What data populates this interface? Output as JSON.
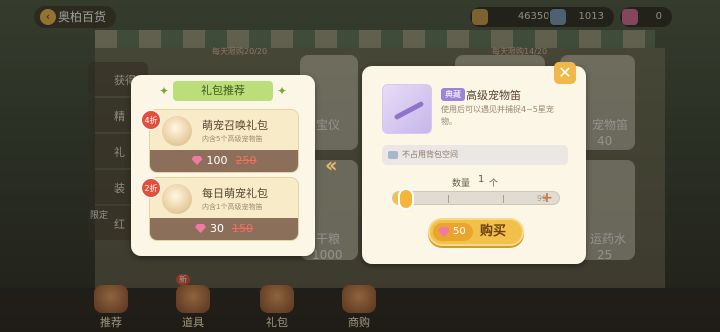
{
  "header": {
    "title": "奥柏百货",
    "resources": [
      {
        "icon": "coin-icon",
        "value": "463502"
      },
      {
        "icon": "crystal-icon",
        "value": "1013"
      },
      {
        "icon": "gem-icon",
        "value": "0"
      }
    ]
  },
  "background": {
    "side_tabs": [
      "获得",
      "精",
      "礼",
      "装",
      "红"
    ],
    "tags": [
      "每天限购20/20",
      "每天限购14/20",
      "限定"
    ],
    "card_labels": [
      "宝仪",
      "宠物笛",
      "苗",
      "干粮",
      "运药水"
    ],
    "prices": [
      "40",
      "1000",
      "25"
    ],
    "bottom_nav": [
      {
        "label": "推荐",
        "icon": "recommend-icon"
      },
      {
        "label": "道具",
        "icon": "items-icon",
        "badge": "新"
      },
      {
        "label": "礼包",
        "icon": "gift-icon"
      },
      {
        "label": "商购",
        "icon": "shop-icon"
      }
    ]
  },
  "gift_panel": {
    "title": "礼包推荐",
    "packs": [
      {
        "discount": "4折",
        "name": "萌宠召唤礼包",
        "desc": "内含5个高级宠物笛",
        "price": "100",
        "original_price": "250"
      },
      {
        "discount": "2折",
        "name": "每日萌宠礼包",
        "desc": "内含1个高级宠物笛",
        "price": "30",
        "original_price": "150"
      }
    ]
  },
  "detail": {
    "rarity": "典藏",
    "name": "高级宠物笛",
    "description": "使用后可以遇见并捕捉4~5星宠物。",
    "bag_note": "不占用背包空间",
    "quantity_label": "数量",
    "quantity_value": "1",
    "quantity_unit": "个",
    "slider_max": "99",
    "slider_fraction": 0.01,
    "buy_price": "50",
    "buy_label": "购买",
    "close_icon": "close-icon"
  },
  "colors": {
    "accent_gold": "#f2c14c",
    "gem_pink": "#f07aa4",
    "header_green": "#b9de7a",
    "rarity_purple": "#9d84d6",
    "price_strike_red": "#f07060"
  }
}
